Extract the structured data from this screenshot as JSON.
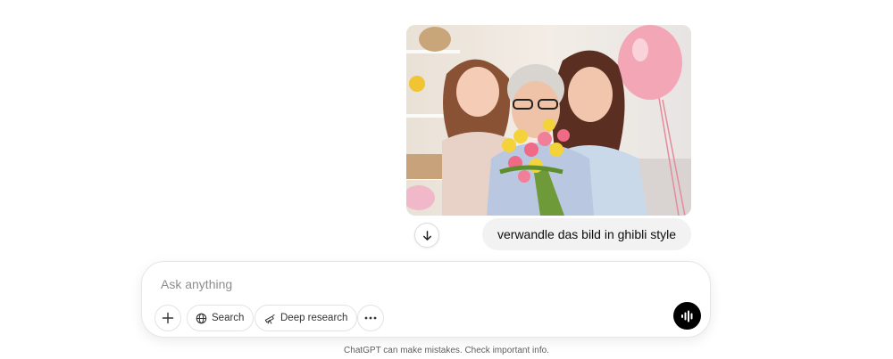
{
  "chat": {
    "user_message": "verwandle das bild in ghibli style"
  },
  "composer": {
    "placeholder": "Ask anything",
    "search_label": "Search",
    "deep_research_label": "Deep research"
  },
  "footer": {
    "disclaimer": "ChatGPT can make mistakes. Check important info."
  },
  "icons": {
    "scroll": "arrow-down-icon",
    "attach": "plus-icon",
    "search": "globe-icon",
    "deep_research": "telescope-icon",
    "more": "ellipsis-icon",
    "voice": "voice-mode-icon"
  }
}
